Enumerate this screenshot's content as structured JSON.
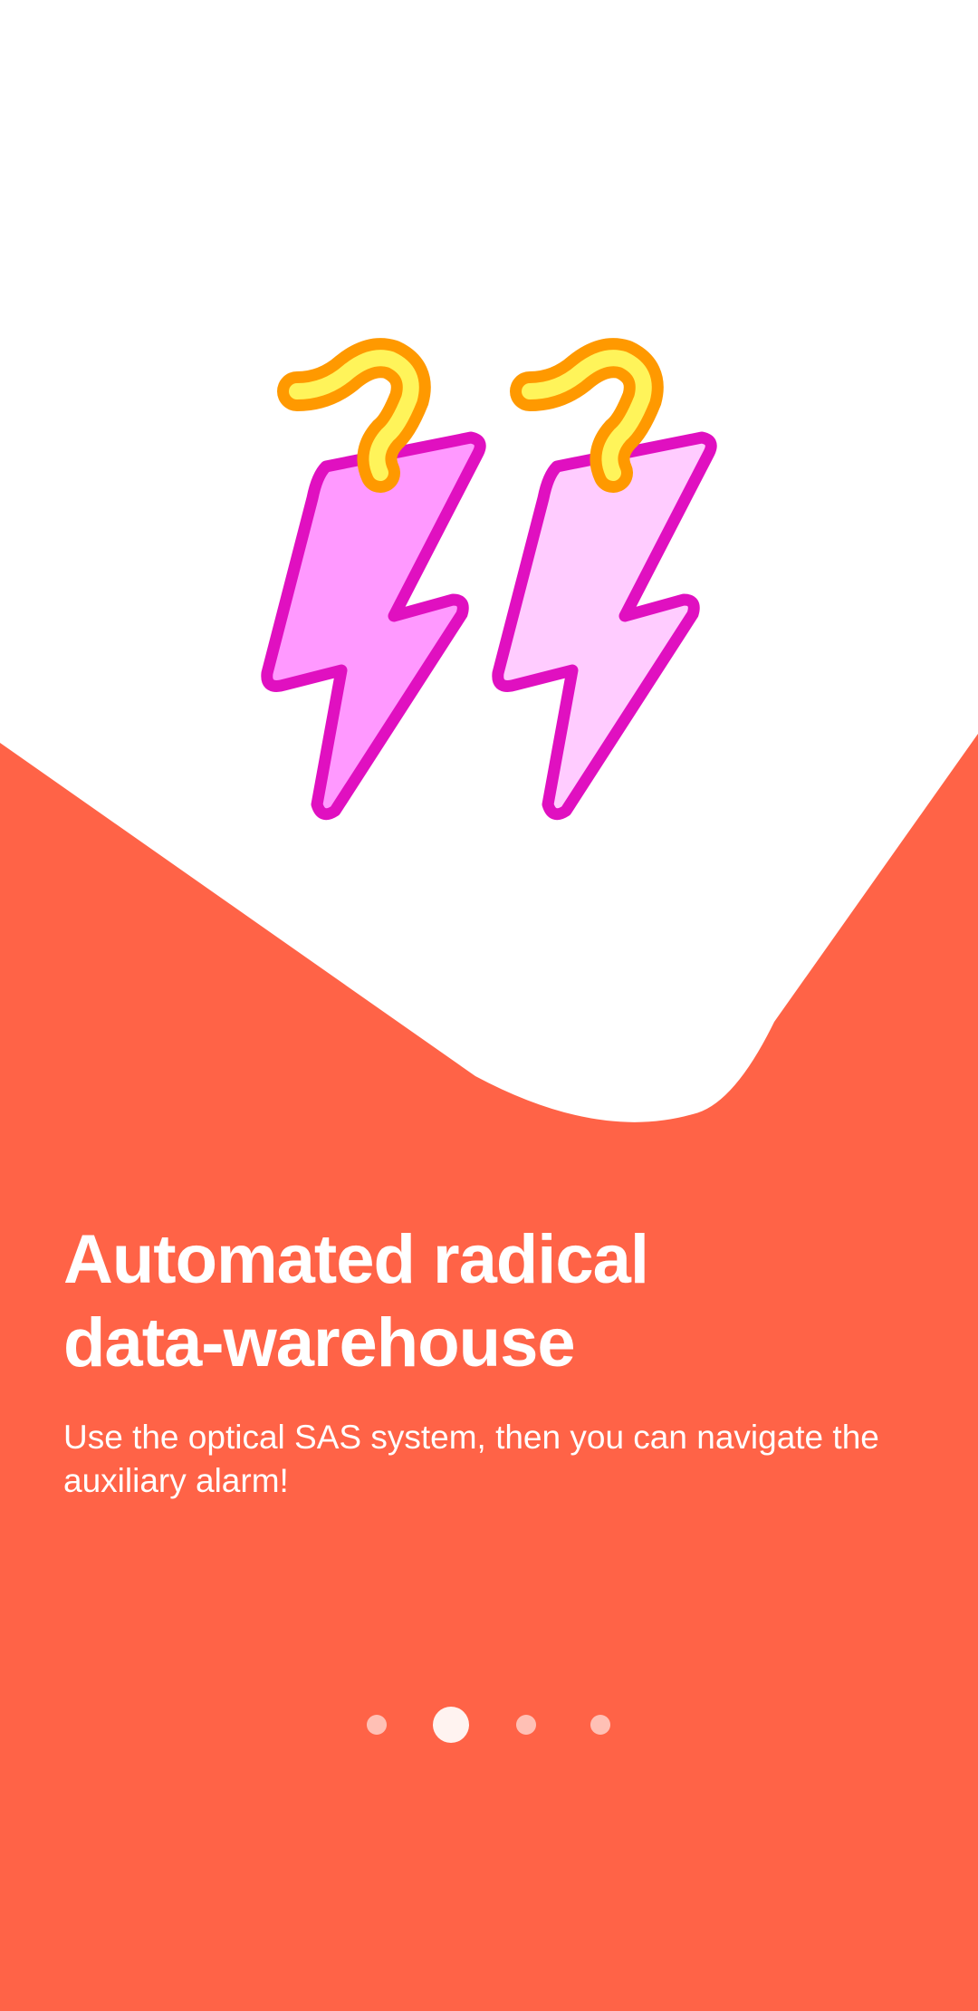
{
  "onboarding": {
    "title": "Automated radical\ndata-warehouse",
    "subtitle": "Use the optical SAS system, then you can navigate the auxiliary alarm!",
    "illustration": "earrings-lightning-bolts",
    "pager": {
      "total": 4,
      "active_index": 1
    }
  },
  "colors": {
    "background_accent": "#FF6347",
    "background_top": "#FFFFFF",
    "bolt_outline": "#E010C0",
    "bolt_fill_left": "#FF99FF",
    "bolt_fill_right": "#FFCCFF",
    "hook_outer": "#FF9900",
    "hook_inner": "#FFF45A"
  }
}
